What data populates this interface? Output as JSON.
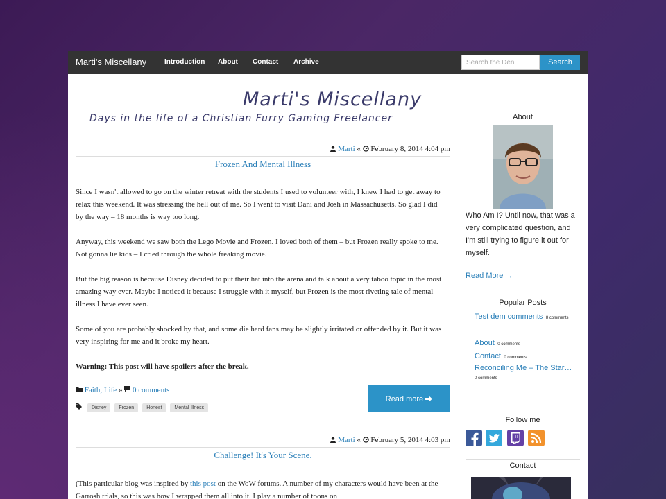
{
  "nav": {
    "brand": "Marti's Miscellany",
    "links": [
      "Introduction",
      "About",
      "Contact",
      "Archive"
    ],
    "search_placeholder": "Search the Den",
    "search_button": "Search"
  },
  "header": {
    "title": "Marti's Miscellany",
    "tagline": "Days in the life of a Christian Furry Gaming Freelancer"
  },
  "post1": {
    "author": "Marti",
    "separator": "«",
    "date": "February 8, 2014 4:04 pm",
    "title": "Frozen And Mental Illness",
    "p1": "Since I wasn't allowed to go on the winter retreat with the students I used to volunteer with, I knew I had to get away to relax this weekend. It was stressing the hell out of me. So I went to visit Dani and Josh in Massachusetts. So glad I did by the way – 18 months is way too long.",
    "p2": "Anyway, this weekend we saw both the Lego Movie and Frozen. I loved both of them – but Frozen really spoke to me. Not gonna lie kids – I cried through the whole freaking movie.",
    "p3": "But the big reason is because Disney decided to put their hat into the arena and talk about a very taboo topic in the most amazing way ever. Maybe I noticed it because I struggle with it myself, but Frozen is the most riveting tale of mental illness I have ever seen.",
    "p4": "Some of you are probably shocked by that, and some die hard fans may be slightly irritated or offended by it. But it was very inspiring for me and it broke my heart.",
    "p5": "Warning: This post will have spoilers after the break.",
    "categories": "Faith, Life",
    "cat_sep": "»",
    "comments": "0 comments",
    "tags": [
      "Disney",
      "Frozen",
      "Honest",
      "Mental Illness"
    ],
    "read_more": "Read more"
  },
  "post2": {
    "author": "Marti",
    "separator": "«",
    "date": "February 5, 2014 4:03 pm",
    "title": "Challenge! It's Your Scene.",
    "p1_pre": "(This particular blog was inspired by ",
    "p1_link": "this post",
    "p1_post": " on the WoW forums. A number of my characters would have been at the Garrosh trials, so this was how I wrapped them all into it. I play a number of toons on"
  },
  "sidebar": {
    "about_heading": "About",
    "about_text": "Who Am I? Until now, that was a very complicated question, and I'm still trying to figure it out for myself.",
    "read_more": "Read More →",
    "popular_heading": "Popular Posts",
    "popular": [
      {
        "title": "Test dem comments",
        "count": "8 comments"
      },
      {
        "title": "About",
        "count": "0 comments"
      },
      {
        "title": "Contact",
        "count": "0 comments"
      },
      {
        "title": "Reconciling Me – The Star…",
        "count": "0 comments"
      }
    ],
    "follow_heading": "Follow me",
    "contact_heading": "Contact"
  },
  "colors": {
    "accent": "#2c93c8",
    "navbar": "#333333",
    "link": "#2a7fb8"
  },
  "icons": [
    "user-icon",
    "clock-icon",
    "folder-icon",
    "comment-icon",
    "tags-icon",
    "arrow-right-icon",
    "facebook-icon",
    "twitter-icon",
    "twitch-icon",
    "rss-icon"
  ]
}
